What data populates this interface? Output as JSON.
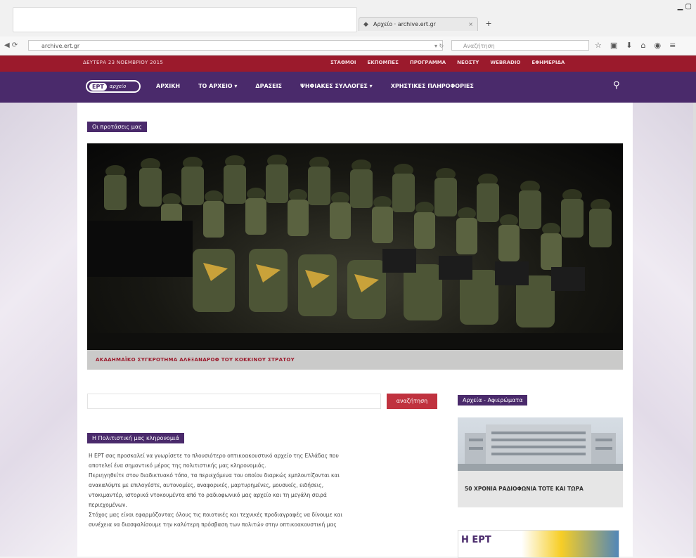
{
  "browser": {
    "tab_title": "Αρχείο · archive.ert.gr",
    "tab_close": "×",
    "new_tab": "+",
    "url": "archive.ert.gr",
    "search_placeholder": "Αναζήτηση",
    "toolbar_icons": [
      "star-icon",
      "reader-icon",
      "download-icon",
      "home-icon",
      "pocket-icon",
      "menu-icon"
    ]
  },
  "topbar": {
    "date": "ΔΕΥΤΕΡΑ 23 ΝΟΕΜΒΡΙΟΥ 2015",
    "links": [
      "ΣΤΑΘΜΟΙ",
      "ΕΚΠΟΜΠΕΣ",
      "ΠΡΟΓΡΑΜΜΑ",
      "ΝΕΟΣΤΥ",
      "WEBRADIO",
      "ΕΦΗΜΕΡΙΔΑ"
    ]
  },
  "nav": {
    "logo_ert": "ΕΡΤ",
    "logo_archive": "αρχείο",
    "items": [
      "ΑΡΧΙΚΗ",
      "ΤΟ ΑΡΧΕΙΟ ▾",
      "ΔΡΑΣΕΙΣ",
      "ΨΗΦΙΑΚΕΣ ΣΥΛΛΟΓΕΣ ▾",
      "ΧΡΗΣΤΙΚΕΣ ΠΛΗΡΟΦΟΡΙΕΣ"
    ]
  },
  "content": {
    "section_label": "Οι προτάσεις μας",
    "hero_caption": "ΑΚΑΔΗΜΑΪΚΟ ΣΥΓΚΡΟΤΗΜΑ ΑΛΕΞΑΝΔΡΟΦ ΤΟΥ ΚΟΚΚΙΝΟΥ ΣΤΡΑΤΟΥ",
    "search_button": "αναζήτηση",
    "heritage_title": "Η Πολιτιστική μας κληρονομιά",
    "heritage_lines": [
      "Η ΕΡΤ σας προσκαλεί να γνωρίσετε το πλουσιότερο οπτικοακουστικό αρχείο της Ελλάδας που",
      "αποτελεί ένα σημαντικό μέρος της πολιτιστικής μας κληρονομιάς.",
      "Περιηγηθείτε στον διαδικτυακό τόπο, τα περιεχόμενα του οποίου διαρκώς εμπλουτίζονται και",
      "ανακαλύψτε με επιλογέστε, αυτονομίες, αναφορικές, μαρτυρημένες, μουσικές, ειδήσεις,",
      "ντοκιμαντέρ, ιστορικά ντοκουμέντα από το ραδιοφωνικό μας αρχείο και τη μεγάλη σειρά",
      "περιεχομένων.",
      "Στόχος μας είναι εφαρμόζοντας όλους τις ποιοτικές και τεχνικές προδιαγραφές να δίνουμε και",
      "συνέχεια να διασφαλίσουμε την καλύτερη πρόσβαση των πολιτών στην οπτικοακουστική μας"
    ],
    "archives_label": "Αρχεία - Αφιερώματα",
    "archives_caption": "50 ΧΡΟΝΙΑ ΡΑΔΙΟΦΩΝΙΑ ΤΟΤΕ ΚΑΙ ΤΩΡΑ",
    "promo_text": "Η ΕΡΤ"
  },
  "colors": {
    "topbar": "#9b1a2c",
    "nav": "#4a2a6b",
    "accent_button": "#c0323f"
  }
}
